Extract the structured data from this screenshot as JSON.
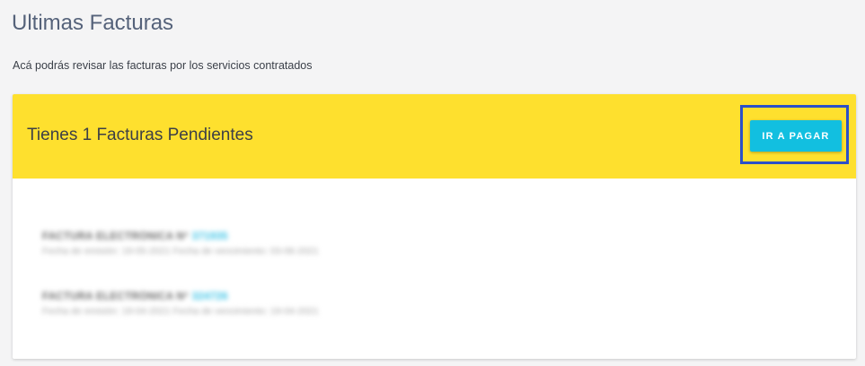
{
  "header": {
    "title": "Ultimas Facturas",
    "subtitle": "Acá podrás revisar las facturas por los servicios contratados"
  },
  "banner": {
    "message": "Tienes 1 Facturas Pendientes",
    "pay_button_label": "IR A PAGAR",
    "background_color": "#fee02e",
    "button_color": "#12bfe0"
  },
  "invoices": [
    {
      "label": "FACTURA ELECTRÓNICA Nº",
      "number": "371935",
      "meta": "Fecha de emisión: 19-05-2021 Fecha de vencimiento: 03-06-2021"
    },
    {
      "label": "FACTURA ELECTRÓNICA Nº",
      "number": "324726",
      "meta": "Fecha de emisión: 19-04-2021 Fecha de vencimiento: 19-04-2021"
    }
  ]
}
